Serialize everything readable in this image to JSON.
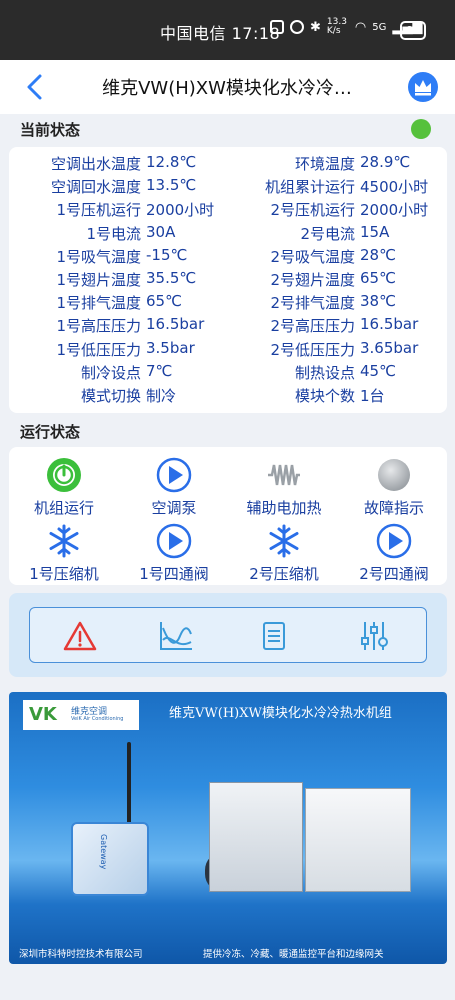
{
  "statusbar": {
    "carrier_time": "中国电信 17:18",
    "network": "13.3 K/s",
    "signal": "5G",
    "battery": "88"
  },
  "appbar": {
    "title": "维克VW(H)XW模块化水冷冷…"
  },
  "current_status": {
    "heading": "当前状态",
    "indicator_color": "#56c13c",
    "rows": [
      {
        "l_label": "空调出水温度",
        "l_value": "12.8℃",
        "r_label": "环境温度",
        "r_value": "28.9℃"
      },
      {
        "l_label": "空调回水温度",
        "l_value": "13.5℃",
        "r_label": "机组累计运行",
        "r_value": "4500小时"
      },
      {
        "l_label": "1号压机运行",
        "l_value": "2000小时",
        "r_label": "2号压机运行",
        "r_value": "2000小时"
      },
      {
        "l_label": "1号电流",
        "l_value": "30A",
        "r_label": "2号电流",
        "r_value": "15A"
      },
      {
        "l_label": "1号吸气温度",
        "l_value": "-15℃",
        "r_label": "2号吸气温度",
        "r_value": "28℃"
      },
      {
        "l_label": "1号翅片温度",
        "l_value": "35.5℃",
        "r_label": "2号翅片温度",
        "r_value": "65℃"
      },
      {
        "l_label": "1号排气温度",
        "l_value": "65℃",
        "r_label": "2号排气温度",
        "r_value": "38℃"
      },
      {
        "l_label": "1号高压压力",
        "l_value": "16.5bar",
        "r_label": "2号高压压力",
        "r_value": "16.5bar"
      },
      {
        "l_label": "1号低压压力",
        "l_value": "3.5bar",
        "r_label": "2号低压压力",
        "r_value": "3.65bar"
      },
      {
        "l_label": "制冷设点",
        "l_value": "7℃",
        "r_label": "制热设点",
        "r_value": "45℃"
      },
      {
        "l_label": "模式切换",
        "l_value": "制冷",
        "r_label": "模块个数",
        "r_value": "1台"
      }
    ]
  },
  "run_status": {
    "heading": "运行状态",
    "items": [
      {
        "label": "机组运行",
        "icon": "power-on-icon",
        "color": "#3bbf3b"
      },
      {
        "label": "空调泵",
        "icon": "play-icon",
        "color": "#2a6ee8"
      },
      {
        "label": "辅助电加热",
        "icon": "heater-coil-icon",
        "color": "#9aa0a6"
      },
      {
        "label": "故障指示",
        "icon": "fault-lamp-icon",
        "color": "#a9adb2"
      },
      {
        "label": "1号压缩机",
        "icon": "snowflake-icon",
        "color": "#2a6ee8"
      },
      {
        "label": "1号四通阀",
        "icon": "play-icon",
        "color": "#2a6ee8"
      },
      {
        "label": "2号压缩机",
        "icon": "snowflake-icon",
        "color": "#2a6ee8"
      },
      {
        "label": "2号四通阀",
        "icon": "play-icon",
        "color": "#2a6ee8"
      }
    ]
  },
  "toolbar": {
    "icons": [
      "alarm-icon",
      "trend-chart-icon",
      "list-icon",
      "settings-sliders-icon"
    ]
  },
  "banner": {
    "title": "维克VW(H)XW模块化水冷冷热水机组",
    "logo_mark": "VK",
    "logo_text": "维克空调",
    "logo_sub": "VeiK Air Conditioning",
    "gateway_text": "Gateway",
    "footer_left": "深圳市科特时控技术有限公司",
    "footer_right": "提供冷冻、冷藏、暖通监控平台和边缘网关"
  }
}
